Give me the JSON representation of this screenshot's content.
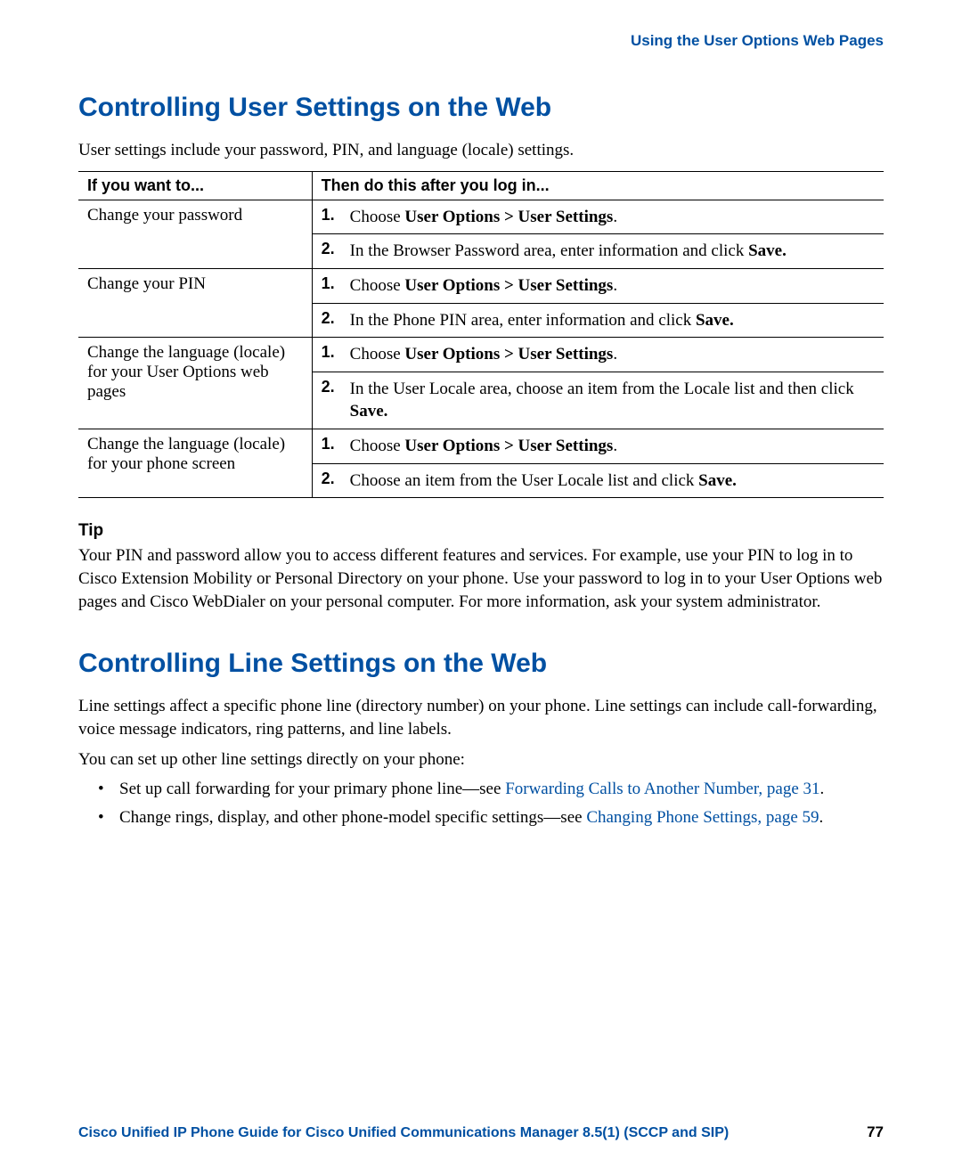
{
  "header": {
    "breadcrumb": "Using the User Options Web Pages"
  },
  "section1": {
    "title": "Controlling User Settings on the Web",
    "intro": "User settings include your password, PIN, and language (locale) settings.",
    "table": {
      "col1": "If you want to...",
      "col2": "Then do this after you log in...",
      "rows": [
        {
          "want": "Change your password",
          "steps": [
            {
              "n": "1.",
              "pre": "Choose ",
              "path": "User Options > User Settings",
              "post": "."
            },
            {
              "n": "2.",
              "pre": "In the Browser Password area, enter information and click ",
              "bold": "Save.",
              "post": ""
            }
          ]
        },
        {
          "want": "Change your PIN",
          "steps": [
            {
              "n": "1.",
              "pre": "Choose ",
              "path": "User Options > User Settings",
              "post": "."
            },
            {
              "n": "2.",
              "pre": "In the Phone PIN area, enter information and click ",
              "bold": "Save.",
              "post": ""
            }
          ]
        },
        {
          "want": "Change the language (locale) for your User Options web pages",
          "steps": [
            {
              "n": "1.",
              "pre": "Choose ",
              "path": "User Options > User Settings",
              "post": "."
            },
            {
              "n": "2.",
              "pre": "In the User Locale area, choose an item from the Locale list and then click ",
              "bold": "Save.",
              "post": ""
            }
          ]
        },
        {
          "want": "Change the language (locale) for your phone screen",
          "steps": [
            {
              "n": "1.",
              "pre": "Choose ",
              "path": "User Options > User Settings",
              "post": "."
            },
            {
              "n": "2.",
              "pre": "Choose an item from the User Locale list and click ",
              "bold": "Save.",
              "post": ""
            }
          ]
        }
      ]
    },
    "tip": {
      "heading": "Tip",
      "body": "Your PIN and password allow you to access different features and services. For example, use your PIN to log in to Cisco Extension Mobility or Personal Directory on your phone. Use your password to log in to your User Options web pages and Cisco WebDialer on your personal computer. For more information, ask your system administrator."
    }
  },
  "section2": {
    "title": "Controlling Line Settings on the Web",
    "p1": "Line settings affect a specific phone line (directory number) on your phone. Line settings can include call-forwarding, voice message indicators, ring patterns, and line labels.",
    "p2": "You can set up other line settings directly on your phone:",
    "bullets": [
      {
        "pre": "Set up call forwarding for your primary phone line—see ",
        "link": "Forwarding Calls to Another Number, page 31",
        "post": "."
      },
      {
        "pre": "Change rings, display, and other phone-model specific settings—see ",
        "link": "Changing Phone Settings, page 59",
        "post": "."
      }
    ]
  },
  "footer": {
    "title": "Cisco Unified IP Phone Guide for Cisco Unified Communications Manager 8.5(1) (SCCP and SIP)",
    "page": "77"
  }
}
